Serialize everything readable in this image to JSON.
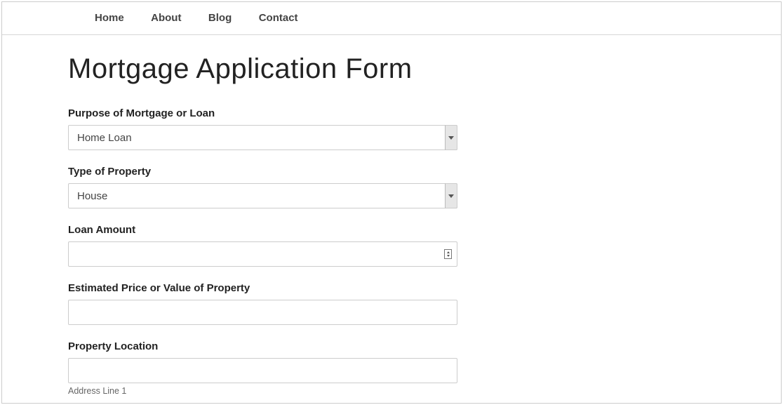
{
  "nav": {
    "items": [
      "Home",
      "About",
      "Blog",
      "Contact"
    ]
  },
  "page": {
    "title": "Mortgage Application Form"
  },
  "form": {
    "purpose": {
      "label": "Purpose of Mortgage or Loan",
      "value": "Home Loan"
    },
    "property_type": {
      "label": "Type of Property",
      "value": "House"
    },
    "loan_amount": {
      "label": "Loan Amount",
      "value": ""
    },
    "estimated_value": {
      "label": "Estimated Price or Value of Property",
      "value": ""
    },
    "location": {
      "label": "Property Location",
      "value": "",
      "sub_label": "Address Line 1"
    }
  }
}
